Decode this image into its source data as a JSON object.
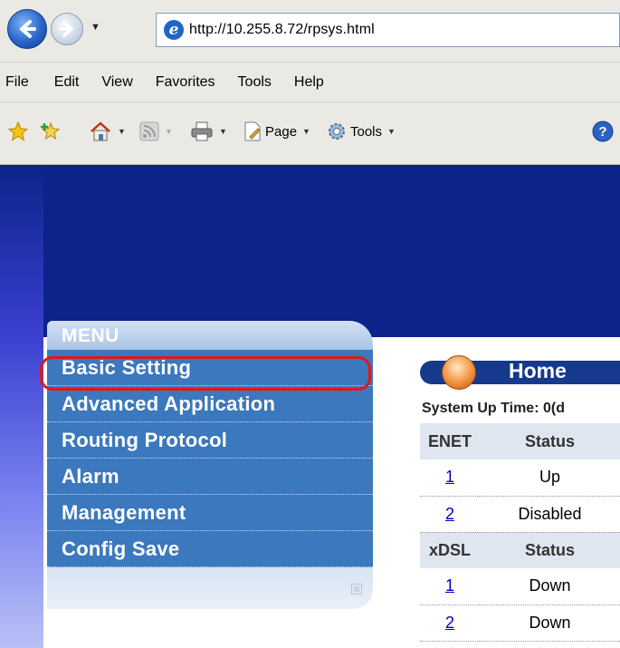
{
  "browser": {
    "url": "http://10.255.8.72/rpsys.html",
    "menu": [
      "File",
      "Edit",
      "View",
      "Favorites",
      "Tools",
      "Help"
    ],
    "command_bar": {
      "page_label": "Page",
      "tools_label": "Tools"
    }
  },
  "side_menu": {
    "header": "MENU",
    "items": [
      "Basic Setting",
      "Advanced Application",
      "Routing Protocol",
      "Alarm",
      "Management",
      "Config Save"
    ],
    "highlighted_item": "Basic Setting"
  },
  "home": {
    "title": "Home",
    "uptime_text": "System Up Time: 0(d"
  },
  "enet_table": {
    "headers": [
      "ENET",
      "Status"
    ],
    "rows": [
      {
        "port": "1",
        "status": "Up"
      },
      {
        "port": "2",
        "status": "Disabled"
      }
    ]
  },
  "xdsl_table": {
    "headers": [
      "xDSL",
      "Status"
    ],
    "rows": [
      {
        "port": "1",
        "status": "Down"
      },
      {
        "port": "2",
        "status": "Down"
      }
    ]
  },
  "colors": {
    "banner": "#0c2489",
    "menu_item_bg": "#3b78bd",
    "highlight_ring": "#e01818",
    "home_pill": "#17398d"
  }
}
